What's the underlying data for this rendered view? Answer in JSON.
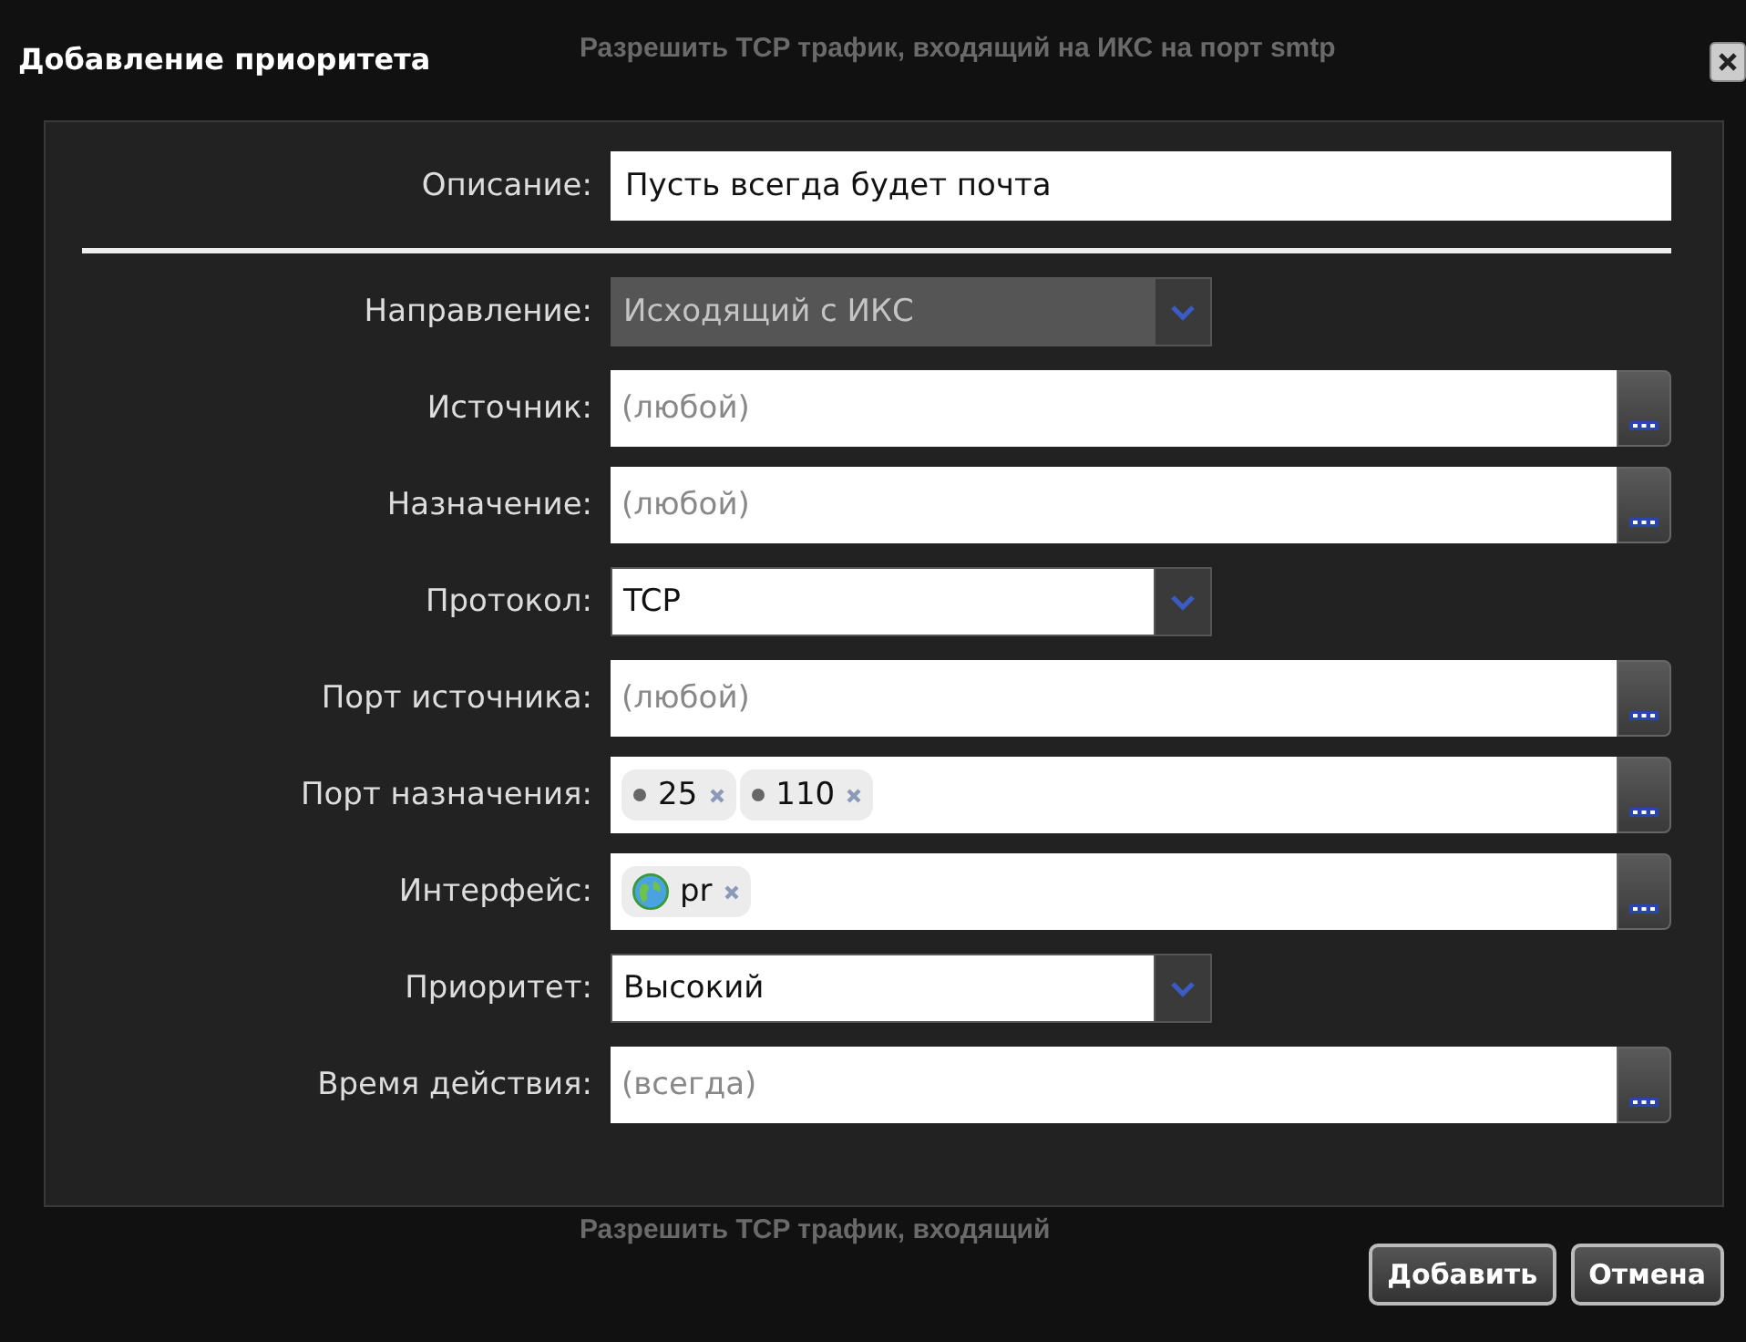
{
  "background": {
    "top_line": "Разрешить TCP трафик, входящий на ИКС на порт smtp",
    "bottom_line": "Разрешить TCP трафик, входящий"
  },
  "dialog": {
    "title": "Добавление приоритета",
    "description": {
      "label": "Описание:",
      "value": "Пусть всегда будет почта"
    },
    "fields": [
      {
        "kind": "select",
        "label": "Направление:",
        "value": "Исходящий с ИКС",
        "disabled": true
      },
      {
        "kind": "picker",
        "label": "Источник:",
        "placeholder": "(любой)"
      },
      {
        "kind": "picker",
        "label": "Назначение:",
        "placeholder": "(любой)"
      },
      {
        "kind": "select",
        "label": "Протокол:",
        "value": "TCP",
        "disabled": false
      },
      {
        "kind": "picker",
        "label": "Порт источника:",
        "placeholder": "(любой)"
      },
      {
        "kind": "tags",
        "label": "Порт назначения:",
        "tags": [
          {
            "kind": "port",
            "text": "25"
          },
          {
            "kind": "port",
            "text": "110"
          }
        ]
      },
      {
        "kind": "tags",
        "label": "Интерфейс:",
        "tags": [
          {
            "kind": "interface",
            "text": "pr"
          }
        ]
      },
      {
        "kind": "select",
        "label": "Приоритет:",
        "value": "Высокий",
        "disabled": false
      },
      {
        "kind": "picker",
        "label": "Время действия:",
        "placeholder": "(всегда)"
      }
    ],
    "buttons": [
      "Добавить",
      "Отмена"
    ]
  }
}
